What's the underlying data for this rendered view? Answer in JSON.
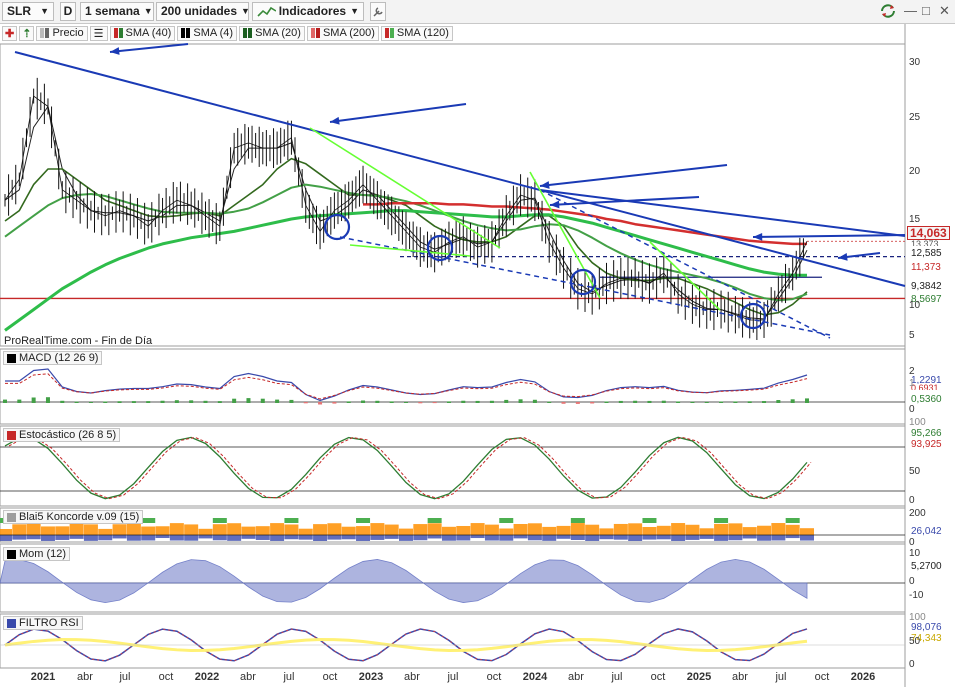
{
  "toolbar": {
    "symbol": "SLR",
    "d_label": "D",
    "timeframe": "1 semana",
    "units": "200 unidades",
    "indicators": "Indicadores"
  },
  "legend": [
    {
      "label": "Precio",
      "color": "#8a8a8a"
    },
    {
      "label": "SMA (40)",
      "color": "#2e7d32"
    },
    {
      "label": "SMA (4)",
      "color": "#000000"
    },
    {
      "label": "SMA (20)",
      "color": "#1b5e20"
    },
    {
      "label": "SMA (200)",
      "color": "#e06666"
    },
    {
      "label": "SMA (120)",
      "color": "#4caf50"
    }
  ],
  "note": "ProRealTime.com - Fin de Día",
  "panels": {
    "macd": {
      "label": "MACD (12 26 9)",
      "values": [
        "1,2291",
        "0,6931",
        "0,5360"
      ],
      "colors": [
        "#3949ab",
        "#c62828",
        "#2e7d32"
      ]
    },
    "stoch": {
      "label": "Estocástico (26 8 5)",
      "values": [
        "95,266",
        "93,925"
      ],
      "colors": [
        "#2e7d32",
        "#c62828"
      ]
    },
    "konc": {
      "label": "Blai5 Koncorde v.09 (15)",
      "values": [
        "26,042"
      ],
      "colors": [
        "#3949ab"
      ]
    },
    "mom": {
      "label": "Mom (12)",
      "values": [
        "5,2700"
      ],
      "colors": [
        "#3949ab"
      ]
    },
    "rsi": {
      "label": "FILTRO RSI",
      "values": [
        "98,076",
        "74,343"
      ],
      "colors": [
        "#3949ab",
        "#c8a800"
      ]
    }
  },
  "price_tags": {
    "current": "14,063",
    "hidden": "13,373",
    "level1": "12,585",
    "level2": "11,373",
    "level3": "9,3842",
    "level4": "8,5697"
  },
  "y_axes": {
    "price": [
      "30",
      "25",
      "20",
      "15",
      "10",
      "5"
    ],
    "macd": [
      "2",
      "1",
      "0"
    ],
    "stoch": [
      "100",
      "50",
      "0"
    ],
    "konc": [
      "200",
      "0"
    ],
    "mom": [
      "10",
      "0",
      "-10"
    ],
    "rsi": [
      "100",
      "50",
      "0"
    ]
  },
  "x_axis": [
    {
      "label": "2021",
      "bold": true
    },
    {
      "label": "abr",
      "bold": false
    },
    {
      "label": "jul",
      "bold": false
    },
    {
      "label": "oct",
      "bold": false
    },
    {
      "label": "2022",
      "bold": true
    },
    {
      "label": "abr",
      "bold": false
    },
    {
      "label": "jul",
      "bold": false
    },
    {
      "label": "oct",
      "bold": false
    },
    {
      "label": "2023",
      "bold": true
    },
    {
      "label": "abr",
      "bold": false
    },
    {
      "label": "jul",
      "bold": false
    },
    {
      "label": "oct",
      "bold": false
    },
    {
      "label": "2024",
      "bold": true
    },
    {
      "label": "abr",
      "bold": false
    },
    {
      "label": "jul",
      "bold": false
    },
    {
      "label": "oct",
      "bold": false
    },
    {
      "label": "2025",
      "bold": true
    },
    {
      "label": "abr",
      "bold": false
    },
    {
      "label": "jul",
      "bold": false
    },
    {
      "label": "oct",
      "bold": false
    },
    {
      "label": "2026",
      "bold": true
    }
  ],
  "chart_data": {
    "type": "line",
    "symbol": "SLR",
    "timeframe": "1 semana",
    "x_range": [
      "2020-12",
      "2026-02"
    ],
    "ylim": [
      4,
      33
    ],
    "price_series": {
      "name": "Precio",
      "x": [
        "2020-12",
        "2021-01",
        "2021-02",
        "2021-03",
        "2021-04",
        "2021-05",
        "2021-06",
        "2021-07",
        "2021-08",
        "2021-09",
        "2021-10",
        "2021-11",
        "2021-12",
        "2022-01",
        "2022-02",
        "2022-03",
        "2022-04",
        "2022-05",
        "2022-06",
        "2022-07",
        "2022-08",
        "2022-09",
        "2022-10",
        "2022-11",
        "2022-12",
        "2023-01",
        "2023-02",
        "2023-03",
        "2023-04",
        "2023-05",
        "2023-06",
        "2023-07",
        "2023-08",
        "2023-09",
        "2023-10",
        "2023-11",
        "2023-12",
        "2024-01",
        "2024-02",
        "2024-03",
        "2024-04",
        "2024-05",
        "2024-06",
        "2024-07",
        "2024-08",
        "2024-09",
        "2024-10",
        "2024-11",
        "2024-12",
        "2025-01",
        "2025-02",
        "2025-03",
        "2025-04",
        "2025-05",
        "2025-06",
        "2025-07",
        "2025-08"
      ],
      "values": [
        18,
        20,
        28,
        27,
        19,
        18,
        17,
        16.5,
        17,
        16.5,
        15.5,
        17,
        18,
        17.5,
        16.5,
        15.5,
        23,
        23.5,
        23,
        23,
        24,
        17.5,
        15,
        17,
        18,
        19.5,
        18,
        16.5,
        15,
        13.5,
        13,
        14,
        14.5,
        13.5,
        14,
        16.5,
        18.5,
        18,
        14,
        11.5,
        9.5,
        9,
        10,
        10.5,
        10.5,
        10,
        11,
        9,
        8,
        7.5,
        7.5,
        7,
        6.5,
        6.5,
        9,
        11,
        14.06
      ]
    },
    "series": [
      {
        "name": "SMA (4)",
        "values": [
          18,
          19,
          25,
          27,
          21,
          18.5,
          17,
          16.8,
          16.8,
          16.5,
          16,
          16.5,
          17.5,
          17.5,
          16.8,
          16,
          21,
          23,
          23,
          23,
          23.5,
          19,
          16,
          16.5,
          17.5,
          19,
          18.5,
          17,
          15.5,
          14,
          13.3,
          13.8,
          14.3,
          13.8,
          14,
          16,
          18,
          18.2,
          15,
          12.2,
          10,
          9.2,
          9.8,
          10.3,
          10.4,
          10.1,
          10.7,
          9.4,
          8.3,
          7.6,
          7.5,
          7.1,
          6.7,
          6.6,
          8.5,
          10.5,
          13.2
        ]
      },
      {
        "name": "SMA (20)",
        "values": [
          16,
          17,
          19.5,
          21,
          21,
          20,
          19,
          18,
          17.5,
          17,
          16.5,
          16.4,
          16.5,
          16.7,
          16.8,
          16.5,
          17.5,
          18.5,
          19.5,
          21,
          22,
          21.5,
          20.5,
          19.5,
          18.5,
          18.5,
          18.5,
          18,
          17.5,
          16.5,
          15.5,
          14.8,
          14.2,
          14,
          14,
          14.5,
          15.5,
          16.5,
          16.5,
          15.5,
          13.5,
          12,
          11,
          10.5,
          10.3,
          10.3,
          10.5,
          10.5,
          10,
          9.5,
          8.8,
          8.2,
          7.5,
          7,
          7.2,
          8,
          9.2
        ]
      },
      {
        "name": "SMA (40)",
        "values": [
          14.5,
          15.5,
          16.5,
          17.5,
          18.2,
          18.5,
          18.6,
          18.4,
          18,
          17.6,
          17.2,
          16.9,
          16.8,
          16.8,
          16.8,
          16.7,
          16.9,
          17.2,
          17.8,
          18.5,
          19.2,
          19.5,
          19.3,
          19,
          18.7,
          18.5,
          18.4,
          18.2,
          17.9,
          17.5,
          17,
          16.5,
          16,
          15.6,
          15.3,
          15.1,
          15.2,
          15.5,
          15.7,
          15.6,
          15.1,
          14.4,
          13.6,
          12.9,
          12.3,
          11.8,
          11.4,
          11.1,
          10.8,
          10.5,
          10.1,
          9.6,
          9,
          8.6,
          8.4,
          8.5,
          9
        ]
      },
      {
        "name": "SMA (120)",
        "values": [
          5.5,
          6.5,
          7.5,
          8.5,
          9.5,
          10.3,
          11.1,
          11.8,
          12.4,
          12.9,
          13.4,
          13.8,
          14.1,
          14.4,
          14.6,
          14.8,
          15,
          15.3,
          15.6,
          15.9,
          16.2,
          16.4,
          16.5,
          16.6,
          16.7,
          16.8,
          16.9,
          17,
          17,
          16.9,
          16.8,
          16.7,
          16.6,
          16.5,
          16.4,
          16.4,
          16.5,
          16.6,
          16.6,
          16.4,
          16.1,
          15.8,
          15.4,
          15,
          14.6,
          14.2,
          13.8,
          13.4,
          13,
          12.6,
          12.2,
          11.8,
          11.4,
          11.1,
          10.9,
          10.8,
          10.8
        ]
      },
      {
        "name": "SMA (200)",
        "values": [
          null,
          null,
          null,
          null,
          null,
          null,
          null,
          null,
          null,
          null,
          null,
          null,
          null,
          null,
          null,
          null,
          null,
          null,
          null,
          null,
          null,
          null,
          null,
          null,
          null,
          17.6,
          17.6,
          17.7,
          17.7,
          17.7,
          17.7,
          17.6,
          17.6,
          17.5,
          17.4,
          17.4,
          17.3,
          17.2,
          17.1,
          16.9,
          16.7,
          16.5,
          16.2,
          16,
          15.7,
          15.5,
          15.3,
          15.1,
          14.9,
          14.7,
          14.5,
          14.3,
          14.1,
          14,
          13.9,
          13.8,
          13.8
        ]
      }
    ],
    "horizontal_levels": [
      12.585,
      11.373,
      8.5697
    ]
  }
}
